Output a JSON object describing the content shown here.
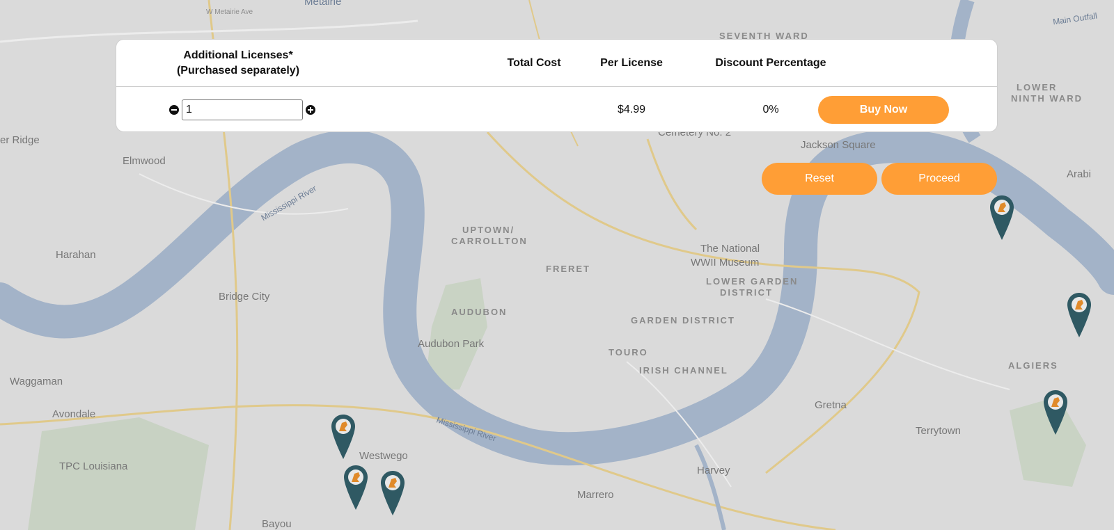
{
  "map": {
    "labels": [
      {
        "text": "W Metairie Ave",
        "cls": "small"
      },
      {
        "text": "Metairie",
        "cls": ""
      },
      {
        "text": "SEVENTH WARD",
        "cls": "district"
      },
      {
        "text": "Main Outfall",
        "cls": "water"
      },
      {
        "text": "LOWER",
        "cls": "district"
      },
      {
        "text": "NINTH WARD",
        "cls": "district"
      },
      {
        "text": "er Ridge",
        "cls": ""
      },
      {
        "text": "Elmwood",
        "cls": ""
      },
      {
        "text": "Cemetery No. 2",
        "cls": ""
      },
      {
        "text": "Jackson Square",
        "cls": ""
      },
      {
        "text": "Arabi",
        "cls": ""
      },
      {
        "text": "Harahan",
        "cls": ""
      },
      {
        "text": "UPTOWN/",
        "cls": "district"
      },
      {
        "text": "CARROLLTON",
        "cls": "district"
      },
      {
        "text": "FRERET",
        "cls": "district"
      },
      {
        "text": "The National",
        "cls": ""
      },
      {
        "text": "WWII Museum",
        "cls": ""
      },
      {
        "text": "LOWER GARDEN",
        "cls": "district"
      },
      {
        "text": "DISTRICT",
        "cls": "district"
      },
      {
        "text": "Bridge City",
        "cls": ""
      },
      {
        "text": "AUDUBON",
        "cls": "district"
      },
      {
        "text": "GARDEN DISTRICT",
        "cls": "district"
      },
      {
        "text": "Audubon Park",
        "cls": ""
      },
      {
        "text": "TOURO",
        "cls": "district"
      },
      {
        "text": "IRISH CHANNEL",
        "cls": "district"
      },
      {
        "text": "ALGIERS",
        "cls": "district"
      },
      {
        "text": "Waggaman",
        "cls": ""
      },
      {
        "text": "Gretna",
        "cls": ""
      },
      {
        "text": "Avondale",
        "cls": ""
      },
      {
        "text": "Terrytown",
        "cls": ""
      },
      {
        "text": "Westwego",
        "cls": ""
      },
      {
        "text": "TPC Louisiana",
        "cls": ""
      },
      {
        "text": "Harvey",
        "cls": ""
      },
      {
        "text": "Marrero",
        "cls": ""
      },
      {
        "text": "Bayou",
        "cls": ""
      },
      {
        "text": "Mississippi River",
        "cls": "water"
      },
      {
        "text": "Mississippi River",
        "cls": "water"
      }
    ]
  },
  "table": {
    "headers": {
      "licenses_line1": "Additional Licenses*",
      "licenses_line2": "(Purchased separately)",
      "total_cost": "Total Cost",
      "per_license": "Per License",
      "discount": "Discount Percentage"
    },
    "row": {
      "quantity": "1",
      "total_cost": "",
      "per_license": "$4.99",
      "discount": "0%",
      "buy_label": "Buy Now"
    }
  },
  "actions": {
    "reset_label": "Reset",
    "proceed_label": "Proceed"
  },
  "colors": {
    "accent": "#ff9e36",
    "pin": "#2f5963",
    "river": "#9fb0c6"
  },
  "icons": [
    "minus-circle-icon",
    "plus-circle-icon",
    "map-pin-icon"
  ]
}
